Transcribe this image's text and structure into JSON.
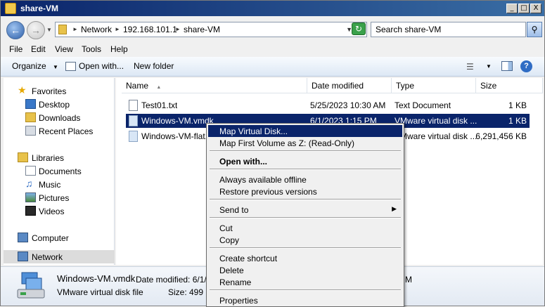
{
  "window": {
    "title": "share-VM",
    "controls": [
      "_",
      "□",
      "X"
    ]
  },
  "address": {
    "crumbs": [
      "Network",
      "192.168.101.1",
      "share-VM"
    ],
    "search_placeholder": "Search share-VM"
  },
  "menubar": [
    "File",
    "Edit",
    "View",
    "Tools",
    "Help"
  ],
  "toolbar": {
    "organize": "Organize",
    "open_with": "Open with...",
    "new_folder": "New folder"
  },
  "nav": {
    "favorites": "Favorites",
    "desktop": "Desktop",
    "downloads": "Downloads",
    "recent_places": "Recent Places",
    "libraries": "Libraries",
    "documents": "Documents",
    "music": "Music",
    "pictures": "Pictures",
    "videos": "Videos",
    "computer": "Computer",
    "network": "Network"
  },
  "columns": {
    "name": "Name",
    "date_modified": "Date modified",
    "type": "Type",
    "size": "Size"
  },
  "files": [
    {
      "name": "Test01.txt",
      "date": "5/25/2023 10:30 AM",
      "type": "Text Document",
      "size": "1 KB"
    },
    {
      "name": "Windows-VM.vmdk",
      "date": "6/1/2023 1:15 PM",
      "type": "VMware virtual disk ...",
      "size": "1 KB"
    },
    {
      "name": "Windows-VM-flat.v",
      "date": "",
      "type": "VMware virtual disk ...",
      "size": "6,291,456 KB"
    }
  ],
  "details": {
    "filename": "Windows-VM.vmdk",
    "date_label": "Date modified: 6/1/2",
    "type": "VMware virtual disk file",
    "size_label": "Size: 499 b",
    "trailing": "M"
  },
  "context_menu": {
    "map_virtual_disk": "Map Virtual Disk...",
    "map_first_volume": "Map First Volume as Z: (Read-Only)",
    "open_with": "Open with...",
    "always_offline": "Always available offline",
    "restore_versions": "Restore previous versions",
    "send_to": "Send to",
    "cut": "Cut",
    "copy": "Copy",
    "create_shortcut": "Create shortcut",
    "delete": "Delete",
    "rename": "Rename",
    "properties": "Properties"
  }
}
